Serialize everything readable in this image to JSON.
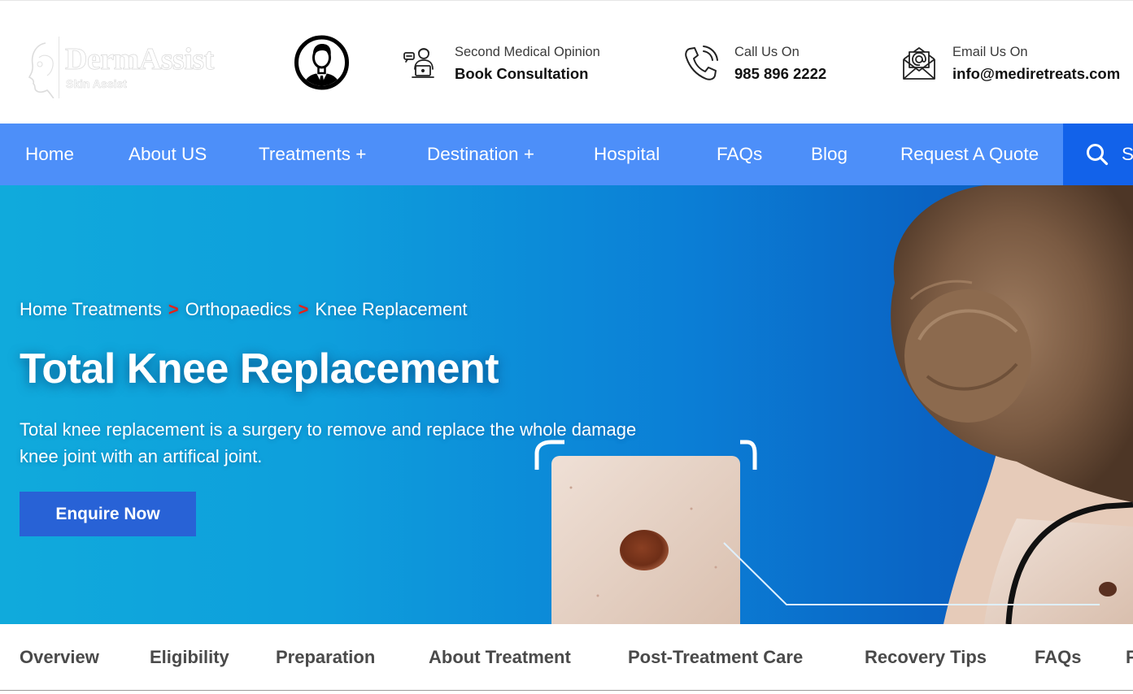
{
  "brand": {
    "name": "DermAssist",
    "tagline": "Skin Assist"
  },
  "header": {
    "consultation": {
      "small": "Second Medical Opinion",
      "big": "Book Consultation",
      "icon": "doctor-laptop-icon"
    },
    "phone": {
      "small": "Call Us On",
      "big": "985 896 2222",
      "icon": "phone-icon"
    },
    "email": {
      "small": "Email Us On",
      "big": "info@mediretreats.com",
      "icon": "email-icon"
    },
    "avatar_icon": "user-avatar-icon"
  },
  "nav": {
    "items": [
      "Home",
      "About US",
      "Treatments +",
      "Destination +",
      "Hospital",
      "FAQs",
      "Blog",
      "Request A Quote"
    ],
    "search_label": "S",
    "search_icon": "search-icon"
  },
  "hero": {
    "breadcrumb": [
      "Home Treatments",
      "Orthopaedics",
      "Knee Replacement"
    ],
    "breadcrumb_separator": ">",
    "title": "Total Knee Replacement",
    "description": "Total knee replacement is a surgery to remove and replace the whole damage knee joint with an artifical joint.",
    "button": "Enquire Now"
  },
  "tabs": [
    "Overview",
    "Eligibility",
    "Preparation",
    "About Treatment",
    "Post-Treatment Care",
    "Recovery Tips",
    "FAQs",
    "F"
  ],
  "colors": {
    "nav_bg": "#4d8ff9",
    "search_bg": "#1262ea",
    "button_bg": "#2862d6",
    "breadcrumb_separator": "#e2231a",
    "hero_gradient_start": "#10aadc",
    "hero_gradient_end": "#0a59b8"
  }
}
